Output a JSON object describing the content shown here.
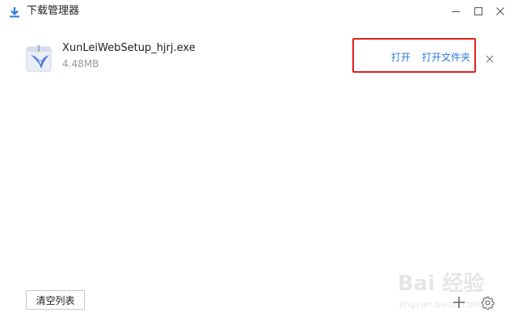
{
  "window": {
    "title": "下载管理器",
    "icon": "download-icon",
    "controls": [
      "minimize-icon",
      "maximize-icon",
      "close-icon"
    ]
  },
  "downloads": [
    {
      "icon": "xunlei-bird-icon",
      "file_name": "XunLeiWebSetup_hjrj.exe",
      "size": "4.48MB",
      "actions": {
        "open": "打开",
        "open_folder": "打开文件夹"
      },
      "remove_icon": "close-icon",
      "highlight_color": "#e02020"
    }
  ],
  "footer": {
    "clear_label": "清空列表",
    "add_icon": "plus-icon",
    "settings_icon": "gear-icon"
  },
  "watermark": {
    "brand": "Bai 经验",
    "url": "jingyan.baidu.com"
  },
  "colors": {
    "link": "#2b7bd9",
    "highlight": "#e02020",
    "accent": "#2b7bd9"
  }
}
